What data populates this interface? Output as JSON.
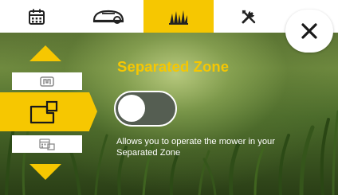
{
  "tabs": [
    {
      "name": "calendar",
      "icon": "calendar-icon",
      "active": false
    },
    {
      "name": "mower",
      "icon": "mower-icon",
      "active": false
    },
    {
      "name": "grass",
      "icon": "grass-icon",
      "active": true
    },
    {
      "name": "tools",
      "icon": "tools-icon",
      "active": false
    }
  ],
  "close": {
    "icon": "close-icon"
  },
  "menu": {
    "items": [
      {
        "icon": "boundary-wire-icon",
        "active": false
      },
      {
        "icon": "separated-zone-icon",
        "active": true
      },
      {
        "icon": "schedule-zone-icon",
        "active": false
      }
    ]
  },
  "content": {
    "title": "Separated Zone",
    "toggle_on": false,
    "description": "Allows you to operate the mower in your Separated Zone"
  },
  "colors": {
    "accent": "#f6c701",
    "background": "#ffffff",
    "text": "#ffffff"
  }
}
